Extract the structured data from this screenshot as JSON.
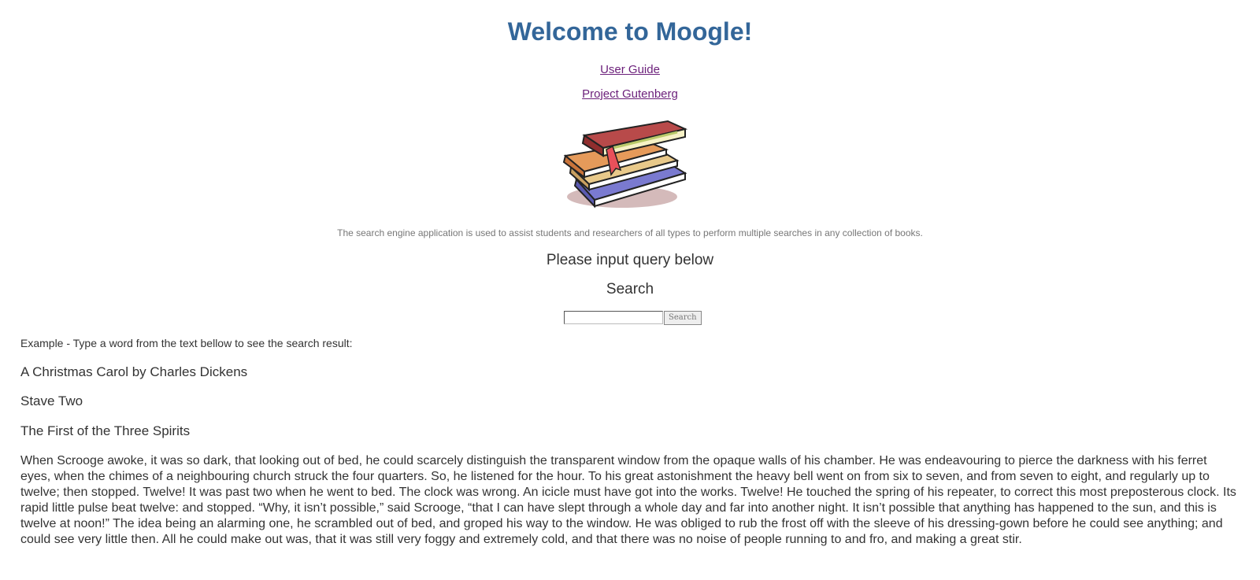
{
  "header": {
    "title": "Welcome to Moogle!",
    "links": [
      "User Guide",
      "Project Gutenberg"
    ]
  },
  "hero": {
    "image_icon": "stack-of-books-icon",
    "description": "The search engine application is used to assist students and researchers of all types to perform multiple searches in any collection of books."
  },
  "search": {
    "prompt": "Please input query below",
    "heading": "Search",
    "input_value": "",
    "button_label": "Search"
  },
  "example": {
    "instruction": "Example - Type a word from the text bellow to see the search result:",
    "book_title": "A Christmas Carol by Charles Dickens",
    "stave": "Stave Two",
    "chapter": "The First of the Three Spirits",
    "paragraph": "When Scrooge awoke, it was so dark, that looking out of bed, he could scarcely distinguish the transparent window from the opaque walls of his chamber. He was endeavouring to pierce the darkness with his ferret eyes, when the chimes of a neighbouring church struck the four quarters. So, he listened for the hour. To his great astonishment the heavy bell went on from six to seven, and from seven to eight, and regularly up to twelve; then stopped. Twelve! It was past two when he went to bed. The clock was wrong. An icicle must have got into the works. Twelve! He touched the spring of his repeater, to correct this most preposterous clock. Its rapid little pulse beat twelve: and stopped. “Why, it isn’t possible,” said Scrooge, “that I can have slept through a whole day and far into another night. It isn’t possible that anything has happened to the sun, and this is twelve at noon!” The idea being an alarming one, he scrambled out of bed, and groped his way to the window. He was obliged to rub the frost off with the sleeve of his dressing-gown before he could see anything; and could see very little then. All he could make out was, that it was still very foggy and extremely cold, and that there was no noise of people running to and fro, and making a great stir."
  },
  "colors": {
    "title": "#336699",
    "link": "#6b1f7a",
    "text": "#333333"
  }
}
